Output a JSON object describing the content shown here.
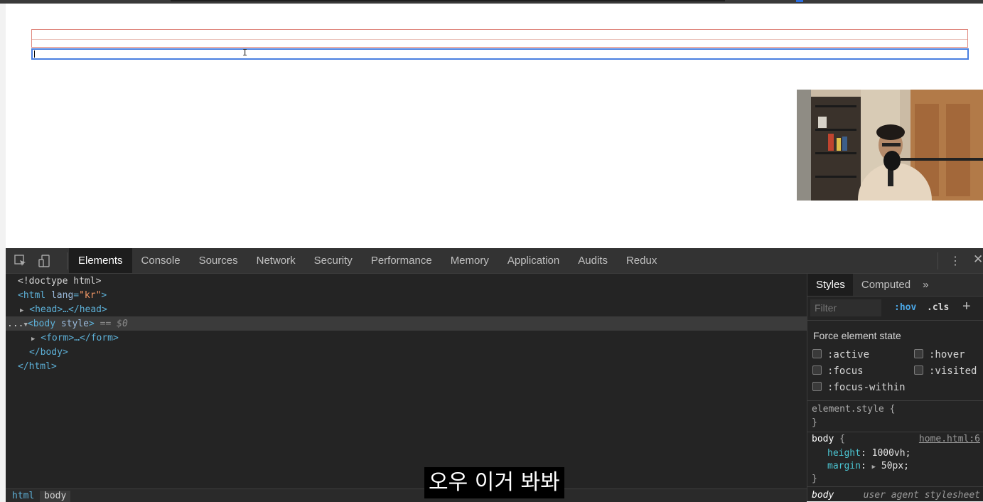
{
  "page": {
    "form_input_value": ""
  },
  "devtools": {
    "tabs": [
      "Elements",
      "Console",
      "Sources",
      "Network",
      "Security",
      "Performance",
      "Memory",
      "Application",
      "Audits",
      "Redux"
    ],
    "active_tab": "Elements",
    "dom": {
      "doctype": "<!doctype html>",
      "html_open_tag": "<html",
      "html_attr": "lang",
      "html_attr_value": "\"kr\"",
      "html_close_bracket": ">",
      "head": "<head>…</head>",
      "body_ellipsis": "...",
      "body_open": "<body",
      "body_attr": "style",
      "body_close_bracket": ">",
      "body_eq": "== $0",
      "form": "<form>…</form>",
      "body_close": "</body>",
      "html_close": "</html>"
    },
    "breadcrumb": [
      "html",
      "body"
    ],
    "styles": {
      "tabs": [
        "Styles",
        "Computed"
      ],
      "more": "»",
      "filter_placeholder": "Filter",
      "hov": ":hov",
      "cls": ".cls",
      "plus": "+",
      "force_state_title": "Force element state",
      "states": [
        ":active",
        ":hover",
        ":focus",
        ":visited",
        ":focus-within"
      ],
      "element_style_open": "element.style {",
      "close_brace": "}",
      "body_selector": "body",
      "open_brace": " {",
      "body_source": "home.html:6",
      "decl_height_prop": "height",
      "decl_height_val": "1000vh;",
      "decl_margin_prop": "margin",
      "decl_margin_val": "50px;",
      "ua_selector": "body",
      "ua_source": "user agent stylesheet"
    }
  },
  "caption": "오우 이거 봐봐",
  "colors": {
    "devtools_bg": "#242424",
    "tag_color": "#5db0d7",
    "accent": "#4a7fe0"
  }
}
